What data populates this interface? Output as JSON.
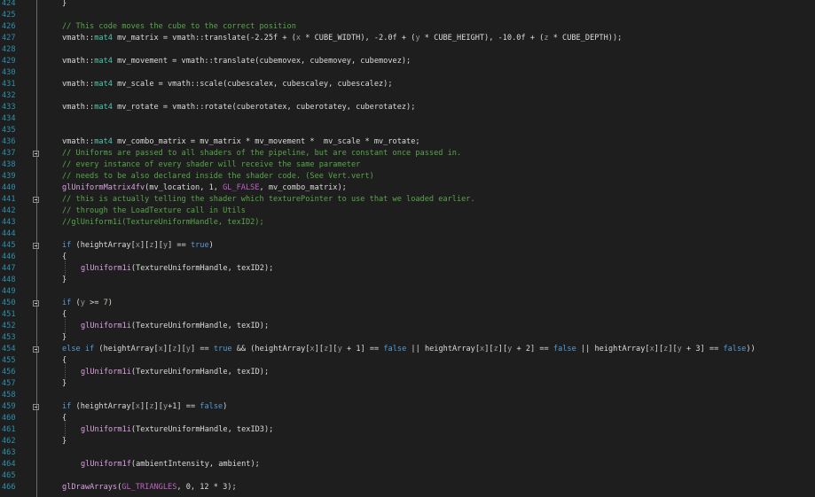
{
  "editor": {
    "lines": [
      {
        "n": "424",
        "indent": 0,
        "tokens": [
          [
            "}",
            "plain"
          ]
        ]
      },
      {
        "n": "425",
        "indent": 0,
        "tokens": []
      },
      {
        "n": "426",
        "indent": 0,
        "tokens": [
          [
            "// This code moves the cube to the correct position",
            "comment"
          ]
        ]
      },
      {
        "n": "427",
        "indent": 0,
        "tokens": [
          [
            "vmath::",
            "plain"
          ],
          [
            "mat4",
            "type"
          ],
          [
            " mv_matrix = vmath::translate(-2.25f + (",
            "plain"
          ],
          [
            "x",
            "var"
          ],
          [
            " * CUBE_WIDTH), -2.0f + (",
            "plain"
          ],
          [
            "y",
            "var"
          ],
          [
            " * CUBE_HEIGHT), -10.0f + (",
            "plain"
          ],
          [
            "z",
            "var"
          ],
          [
            " * CUBE_DEPTH));",
            "plain"
          ]
        ]
      },
      {
        "n": "428",
        "indent": 0,
        "tokens": []
      },
      {
        "n": "429",
        "indent": 0,
        "tokens": [
          [
            "vmath::",
            "plain"
          ],
          [
            "mat4",
            "type"
          ],
          [
            " mv_movement = vmath::translate(cubemovex, cubemovey, cubemovez);",
            "plain"
          ]
        ]
      },
      {
        "n": "430",
        "indent": 0,
        "tokens": []
      },
      {
        "n": "431",
        "indent": 0,
        "tokens": [
          [
            "vmath::",
            "plain"
          ],
          [
            "mat4",
            "type"
          ],
          [
            " mv_scale = vmath::scale(cubescalex, cubescaley, cubescalez);",
            "plain"
          ]
        ]
      },
      {
        "n": "432",
        "indent": 0,
        "tokens": []
      },
      {
        "n": "433",
        "indent": 0,
        "tokens": [
          [
            "vmath::",
            "plain"
          ],
          [
            "mat4",
            "type"
          ],
          [
            " mv_rotate = vmath::rotate(cuberotatex, cuberotatey, cuberotatez);",
            "plain"
          ]
        ]
      },
      {
        "n": "434",
        "indent": 0,
        "tokens": []
      },
      {
        "n": "435",
        "indent": 0,
        "tokens": []
      },
      {
        "n": "436",
        "indent": 0,
        "tokens": [
          [
            "vmath::",
            "plain"
          ],
          [
            "mat4",
            "type"
          ],
          [
            " mv_combo_matrix = mv_matrix * mv_movement *  mv_scale * mv_rotate;",
            "plain"
          ]
        ]
      },
      {
        "n": "437",
        "indent": 0,
        "fold": true,
        "tokens": [
          [
            "// Uniforms are passed to all shaders of the pipeline, but are constant once passed in.",
            "comment"
          ]
        ]
      },
      {
        "n": "438",
        "indent": 0,
        "tokens": [
          [
            "// every instance of every shader will receive the same parameter",
            "comment"
          ]
        ]
      },
      {
        "n": "439",
        "indent": 0,
        "tokens": [
          [
            "// needs to be also declared inside the shader code. (See Vert.vert)",
            "comment"
          ]
        ]
      },
      {
        "n": "440",
        "indent": 0,
        "tokens": [
          [
            "glUniformMatrix4fv",
            "fn"
          ],
          [
            "(mv_location, 1, ",
            "plain"
          ],
          [
            "GL_FALSE",
            "macro"
          ],
          [
            ", mv_combo_matrix);",
            "plain"
          ]
        ]
      },
      {
        "n": "441",
        "indent": 0,
        "fold": true,
        "tokens": [
          [
            "// this is actually telling the shader which texturePointer to use that we loaded earlier.",
            "comment"
          ]
        ]
      },
      {
        "n": "442",
        "indent": 0,
        "tokens": [
          [
            "// through the LoadTexture call in Utils",
            "comment"
          ]
        ]
      },
      {
        "n": "443",
        "indent": 0,
        "tokens": [
          [
            "//glUniform1i(TextureUniformHandle, texID2);",
            "comment"
          ]
        ]
      },
      {
        "n": "444",
        "indent": 0,
        "tokens": []
      },
      {
        "n": "445",
        "indent": 0,
        "fold": true,
        "tokens": [
          [
            "if",
            "kw"
          ],
          [
            " (heightArray[",
            "plain"
          ],
          [
            "x",
            "var"
          ],
          [
            "][",
            "plain"
          ],
          [
            "z",
            "var"
          ],
          [
            "][",
            "plain"
          ],
          [
            "y",
            "var"
          ],
          [
            "] == ",
            "plain"
          ],
          [
            "true",
            "kw"
          ],
          [
            ")",
            "plain"
          ]
        ]
      },
      {
        "n": "446",
        "indent": 0,
        "tokens": [
          [
            "{",
            "plain"
          ]
        ]
      },
      {
        "n": "447",
        "indent": 1,
        "tokens": [
          [
            "glUniform1i",
            "fn"
          ],
          [
            "(TextureUniformHandle, texID2);",
            "plain"
          ]
        ]
      },
      {
        "n": "448",
        "indent": 0,
        "tokens": [
          [
            "}",
            "plain"
          ]
        ]
      },
      {
        "n": "449",
        "indent": 0,
        "tokens": []
      },
      {
        "n": "450",
        "indent": 0,
        "fold": true,
        "tokens": [
          [
            "if",
            "kw"
          ],
          [
            " (",
            "plain"
          ],
          [
            "y",
            "var"
          ],
          [
            " >= ",
            "plain"
          ],
          [
            "7",
            "num"
          ],
          [
            ")",
            "plain"
          ]
        ]
      },
      {
        "n": "451",
        "indent": 0,
        "tokens": [
          [
            "{",
            "plain"
          ]
        ]
      },
      {
        "n": "452",
        "indent": 1,
        "tokens": [
          [
            "glUniform1i",
            "fn"
          ],
          [
            "(TextureUniformHandle, texID);",
            "plain"
          ]
        ]
      },
      {
        "n": "453",
        "indent": 0,
        "tokens": [
          [
            "}",
            "plain"
          ]
        ]
      },
      {
        "n": "454",
        "indent": 0,
        "fold": true,
        "tokens": [
          [
            "else",
            "kw"
          ],
          [
            " ",
            "plain"
          ],
          [
            "if",
            "kw"
          ],
          [
            " (heightArray[",
            "plain"
          ],
          [
            "x",
            "var"
          ],
          [
            "][",
            "plain"
          ],
          [
            "z",
            "var"
          ],
          [
            "][",
            "plain"
          ],
          [
            "y",
            "var"
          ],
          [
            "] == ",
            "plain"
          ],
          [
            "true",
            "kw"
          ],
          [
            " && (heightArray[",
            "plain"
          ],
          [
            "x",
            "var"
          ],
          [
            "][",
            "plain"
          ],
          [
            "z",
            "var"
          ],
          [
            "][",
            "plain"
          ],
          [
            "y",
            "var"
          ],
          [
            " + 1] == ",
            "plain"
          ],
          [
            "false",
            "kw"
          ],
          [
            " || heightArray[",
            "plain"
          ],
          [
            "x",
            "var"
          ],
          [
            "][",
            "plain"
          ],
          [
            "z",
            "var"
          ],
          [
            "][",
            "plain"
          ],
          [
            "y",
            "var"
          ],
          [
            " + 2] == ",
            "plain"
          ],
          [
            "false",
            "kw"
          ],
          [
            " || heightArray[",
            "plain"
          ],
          [
            "x",
            "var"
          ],
          [
            "][",
            "plain"
          ],
          [
            "z",
            "var"
          ],
          [
            "][",
            "plain"
          ],
          [
            "y",
            "var"
          ],
          [
            " + 3] == ",
            "plain"
          ],
          [
            "false",
            "kw"
          ],
          [
            "))",
            "plain"
          ]
        ]
      },
      {
        "n": "455",
        "indent": 0,
        "tokens": [
          [
            "{",
            "plain"
          ]
        ]
      },
      {
        "n": "456",
        "indent": 1,
        "tokens": [
          [
            "glUniform1i",
            "fn"
          ],
          [
            "(TextureUniformHandle, texID);",
            "plain"
          ]
        ]
      },
      {
        "n": "457",
        "indent": 0,
        "tokens": [
          [
            "}",
            "plain"
          ]
        ]
      },
      {
        "n": "458",
        "indent": 0,
        "tokens": []
      },
      {
        "n": "459",
        "indent": 0,
        "fold": true,
        "tokens": [
          [
            "if",
            "kw"
          ],
          [
            " (heightArray[",
            "plain"
          ],
          [
            "x",
            "var"
          ],
          [
            "][",
            "plain"
          ],
          [
            "z",
            "var"
          ],
          [
            "][",
            "plain"
          ],
          [
            "y",
            "var"
          ],
          [
            "+1] == ",
            "plain"
          ],
          [
            "false",
            "kw"
          ],
          [
            ")",
            "plain"
          ]
        ]
      },
      {
        "n": "460",
        "indent": 0,
        "tokens": [
          [
            "{",
            "plain"
          ]
        ]
      },
      {
        "n": "461",
        "indent": 1,
        "tokens": [
          [
            "glUniform1i",
            "fn"
          ],
          [
            "(TextureUniformHandle, texID3);",
            "plain"
          ]
        ]
      },
      {
        "n": "462",
        "indent": 0,
        "tokens": [
          [
            "}",
            "plain"
          ]
        ]
      },
      {
        "n": "463",
        "indent": 0,
        "tokens": []
      },
      {
        "n": "464",
        "indent": 1,
        "tokens": [
          [
            "glUniform1f",
            "fn"
          ],
          [
            "(ambientIntensity, ambient);",
            "plain"
          ]
        ]
      },
      {
        "n": "465",
        "indent": 0,
        "tokens": []
      },
      {
        "n": "466",
        "indent": 0,
        "tokens": [
          [
            "glDrawArrays",
            "fn"
          ],
          [
            "(",
            "plain"
          ],
          [
            "GL_TRIANGLES",
            "macro"
          ],
          [
            ", 0, 12 * 3);",
            "plain"
          ]
        ]
      }
    ]
  },
  "colors": {
    "background": "#1e1e1e",
    "line_number": "#2b91af",
    "comment": "#57a64a",
    "keyword": "#569cd6",
    "type": "#4ec9b0",
    "function": "#d8a0df",
    "macro": "#bd63c5",
    "variable": "#9a9a9a",
    "plain": "#dcdcdc"
  }
}
